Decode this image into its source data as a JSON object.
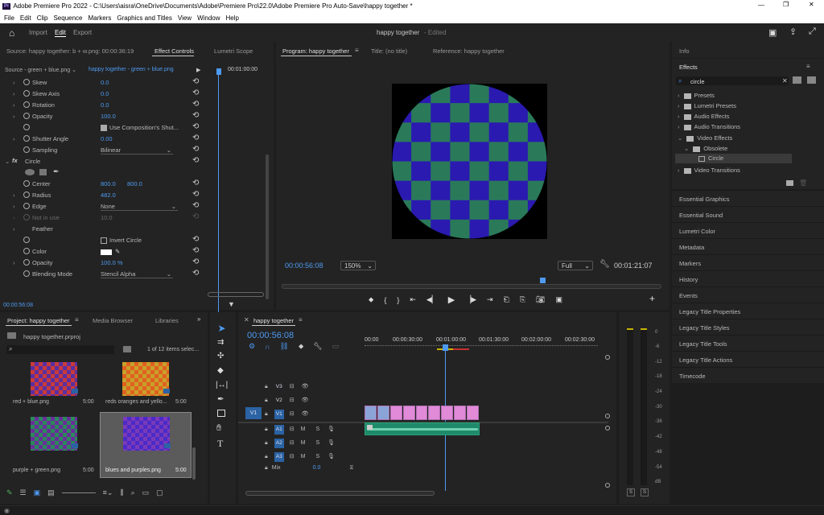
{
  "window": {
    "app_icon": "Pr",
    "title": "Adobe Premiere Pro 2022 - C:\\Users\\aisra\\OneDrive\\Documents\\Adobe\\Premiere Pro\\22.0\\Adobe Premiere Pro Auto-Save\\happy together *"
  },
  "menu": [
    "File",
    "Edit",
    "Clip",
    "Sequence",
    "Markers",
    "Graphics and Titles",
    "View",
    "Window",
    "Help"
  ],
  "workspace": {
    "home_icon": "home-icon",
    "tabs": [
      "Import",
      "Edit",
      "Export"
    ],
    "active": "Edit",
    "project_name": "happy together",
    "edited": "- Edited"
  },
  "source_panel": {
    "tabs": [
      "Source: happy together: b + w.png: 00:00:36:19",
      "Effect Controls",
      "Lumetri Scope"
    ],
    "source_dropdown": "Source - green + blue.png",
    "clip_label": "happy together - green + blue.png",
    "timecode_ruler": "00:01:00:00",
    "props_top": [
      {
        "name": "Skew",
        "value": "0.0"
      },
      {
        "name": "Skew Axis",
        "value": "0.0"
      },
      {
        "name": "Rotation",
        "value": "0.0"
      },
      {
        "name": "Opacity",
        "value": "100.0"
      },
      {
        "name": "",
        "value": "Use Composition's Shut..."
      },
      {
        "name": "Shutter Angle",
        "value": "0.00"
      },
      {
        "name": "Sampling",
        "value": "Bilinear"
      }
    ],
    "circle_effect": "Circle",
    "center_label": "Center",
    "center_x": "800.0",
    "center_y": "800.0",
    "radius_label": "Radius",
    "radius": "482.0",
    "edge_label": "Edge",
    "edge": "None",
    "not_in_use_label": "Not in use",
    "not_in_use": "10.0",
    "feather_label": "Feather",
    "invert_label": "Invert Circle",
    "color_label": "Color",
    "opacity_label": "Opacity",
    "opacity": "100.0 %",
    "blend_label": "Blending Mode",
    "blend": "Stencil Alpha",
    "footer_time": "00:00:56:08"
  },
  "program": {
    "tabs": [
      "Program: happy together",
      "Title: (no title)",
      "Reference: happy together"
    ],
    "timecode": "00:00:56:08",
    "zoom": "150%",
    "quality": "Full",
    "duration": "00:01:21:07"
  },
  "effects_panel": {
    "info_tab": "Info",
    "effects_tab": "Effects",
    "search_value": "circle",
    "tree": [
      "Presets",
      "Lumetri Presets",
      "Audio Effects",
      "Audio Transitions",
      "Video Effects",
      "Obsolete",
      "Circle",
      "Video Transitions"
    ],
    "panels": [
      "Essential Graphics",
      "Essential Sound",
      "Lumetri Color",
      "Metadata",
      "Markers",
      "History",
      "Events",
      "Legacy Title Properties",
      "Legacy Title Styles",
      "Legacy Title Tools",
      "Legacy Title Actions",
      "Timecode"
    ]
  },
  "project": {
    "tabs": [
      "Project: happy together",
      "Media Browser",
      "Libraries"
    ],
    "file": "happy together.prproj",
    "item_count": "1 of 12 items selec...",
    "items": [
      {
        "name": "red + blue.png",
        "duration": "5:00",
        "c1": "#5a2fa0",
        "c2": "#c83a3a"
      },
      {
        "name": "reds oranges and yello...",
        "duration": "5:00",
        "c1": "#e06020",
        "c2": "#c8c83a"
      },
      {
        "name": "purple + green.png",
        "duration": "5:00",
        "c1": "#6a2e9a",
        "c2": "#2a8a5a"
      },
      {
        "name": "blues and purples.png",
        "duration": "5:00",
        "c1": "#4a2ac8",
        "c2": "#7a3ab8"
      }
    ]
  },
  "timeline": {
    "tab": "happy together",
    "timecode": "00:00:56:08",
    "ruler": [
      "00:00",
      "00:00:30:00",
      "00:01:00:00",
      "00:01:30:00",
      "00:02:00:00",
      "00:02:30:00"
    ],
    "video_tracks": [
      "V3",
      "V2",
      "V1"
    ],
    "audio_tracks": [
      "A1",
      "A2",
      "A3"
    ],
    "target_v": "V1",
    "mix_label": "Mix",
    "mix_value": "0.0",
    "mute": "M",
    "solo": "S"
  },
  "meter": {
    "scale": [
      "0",
      "-6",
      "-12",
      "-18",
      "-24",
      "-30",
      "-36",
      "-42",
      "-48",
      "-54",
      "dB"
    ],
    "solo_buttons": [
      "S",
      "S"
    ]
  },
  "colors": {
    "accent": "#4e9af1",
    "clip_pink": "#e08ad8",
    "audio_green": "#1f8a6a",
    "checker_green": "#2a7a5a",
    "checker_blue": "#2a1ab0"
  }
}
